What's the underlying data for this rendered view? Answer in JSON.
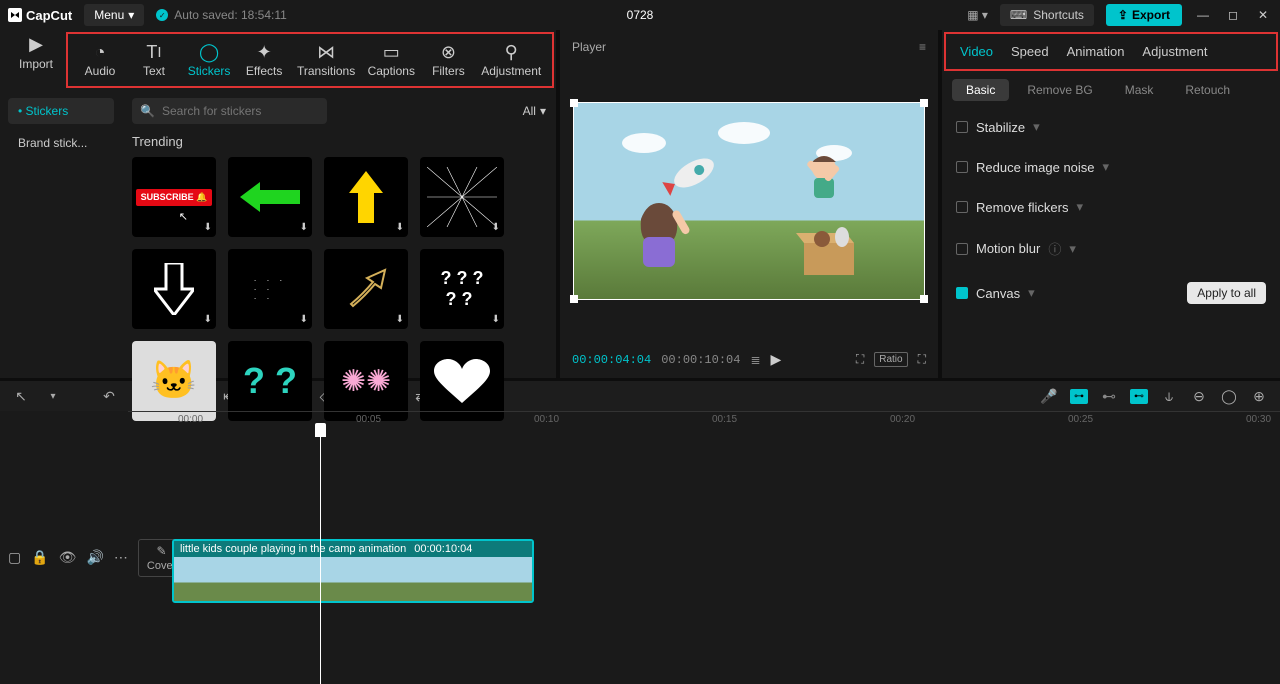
{
  "titlebar": {
    "app": "CapCut",
    "menu": "Menu",
    "autosaved": "Auto saved: 18:54:11",
    "project": "0728",
    "shortcuts": "Shortcuts",
    "export": "Export"
  },
  "main_tabs": {
    "import": "Import",
    "items": [
      {
        "label": "Audio"
      },
      {
        "label": "Text"
      },
      {
        "label": "Stickers"
      },
      {
        "label": "Effects"
      },
      {
        "label": "Transitions"
      },
      {
        "label": "Captions"
      },
      {
        "label": "Filters"
      },
      {
        "label": "Adjustment"
      }
    ],
    "active": "Stickers"
  },
  "stickers": {
    "sidebar": [
      {
        "label": "Stickers",
        "active": true
      },
      {
        "label": "Brand stick..."
      }
    ],
    "search_placeholder": "Search for stickers",
    "all": "All",
    "trending": "Trending"
  },
  "player": {
    "label": "Player",
    "current": "00:00:04:04",
    "total": "00:00:10:04",
    "ratio": "Ratio"
  },
  "props": {
    "tabs": [
      "Video",
      "Speed",
      "Animation",
      "Adjustment"
    ],
    "active": "Video",
    "subtabs": [
      "Basic",
      "Remove BG",
      "Mask",
      "Retouch"
    ],
    "subactive": "Basic",
    "rows": {
      "stabilize": "Stabilize",
      "noise": "Reduce image noise",
      "flickers": "Remove flickers",
      "motion": "Motion blur",
      "canvas": "Canvas"
    },
    "apply": "Apply to all"
  },
  "timeline": {
    "ruler": [
      "00:00",
      "00:05",
      "00:10",
      "00:15",
      "00:20",
      "00:25",
      "00:30"
    ],
    "cover": "Cover",
    "clip": {
      "title": "little kids couple playing in the camp animation",
      "duration": "00:00:10:04"
    }
  }
}
